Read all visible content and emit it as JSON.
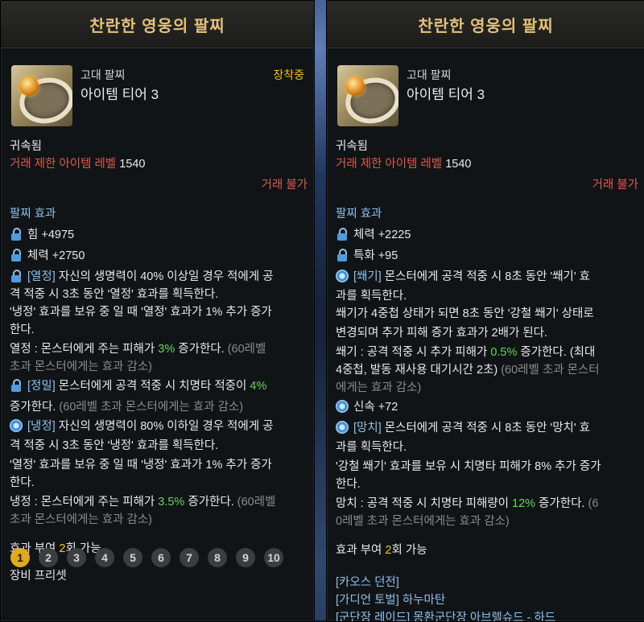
{
  "left": {
    "title": "찬란한 영웅의 팔찌",
    "grade": "고대 팔찌",
    "tier": "아이템 티어 3",
    "equipped": "장착중",
    "bound": "귀속됨",
    "trade_limit_label": "거래 제한 아이템 레벨",
    "trade_limit_value": "1540",
    "untradeable": "거래 불가",
    "effects_header": "팔찌 효과",
    "stat1": "힘 +4975",
    "stat2": "체력 +2750",
    "e1": {
      "tag": "[열정]",
      "l1": " 자신의 생명력이 40% 이상일 경우 적에게 공",
      "l2": "격 적중 시 3초 동안 '열정' 효과를 획득한다.",
      "l3": "'냉정' 효과를 보유 중 일 때 '열정' 효과가 1% 추가 증가",
      "l4": "한다.",
      "l5a": "열정 : 몬스터에게 주는 피해가 ",
      "l5v": "3%",
      "l5b": " 증가한다. ",
      "l5c": "(60레벨",
      "l6": "초과 몬스터에게는 효과 감소)"
    },
    "e2": {
      "tag": "[정밀]",
      "l1a": " 몬스터에게 공격 적중 시 치명타 적중이 ",
      "l1v": "4%",
      "l2a": "증가한다. ",
      "l2b": "(60레벨 초과 몬스터에게는 효과 감소)"
    },
    "e3": {
      "tag": "[냉정]",
      "l1": " 자신의 생명력이 80% 이하일 경우 적에게 공",
      "l2": "격 적중 시 3초 동안 '냉정' 효과를 획득한다.",
      "l3": "'열정' 효과를 보유 중 일 때 '냉정' 효과가 1% 추가 증가",
      "l4": "한다.",
      "l5a": "냉정 : 몬스터에게 주는 피해가 ",
      "l5v": "3.5%",
      "l5b": " 증가한다. ",
      "l5c": "(60레벨",
      "l6": "초과 몬스터에게는 효과 감소)"
    },
    "grant_a": "효과 부여 ",
    "grant_n": "2",
    "grant_b": "회 가능",
    "preset_label": "장비 프리셋",
    "presets": [
      "1",
      "2",
      "3",
      "4",
      "5",
      "6",
      "7",
      "8",
      "9",
      "10"
    ],
    "active_preset": "1"
  },
  "right": {
    "title": "찬란한 영웅의 팔찌",
    "grade": "고대 팔찌",
    "tier": "아이템 티어 3",
    "bound": "귀속됨",
    "trade_limit_label": "거래 제한 아이템 레벨",
    "trade_limit_value": "1540",
    "untradeable": "거래 불가",
    "effects_header": "팔찌 효과",
    "stat1": "체력 +2225",
    "stat2": "특화 +95",
    "e1": {
      "tag": "[쐐기]",
      "l1": " 몬스터에게 공격 적중 시 8초 동안 '쐐기' 효",
      "l2": "과를 획득한다.",
      "l3": "쐐기가 4중첩 상태가 되면 8초 동안 '강철 쐐기' 상태로",
      "l4": "변경되며 추가 피해 증가 효과가 2배가 된다.",
      "l5a": "쐐기 : 공격 적중 시 추가 피해가 ",
      "l5v": "0.5%",
      "l5b": " 증가한다. (최대",
      "l6a": "4중첩, 발동 재사용 대기시간 2초) ",
      "l6b": "(60레벨 초과 몬스터",
      "l7": "에게는 효과 감소)"
    },
    "stat3": "신속 +72",
    "e2": {
      "tag": "[망치]",
      "l1": " 몬스터에게 공격 적중 시 8초 동안 '망치' 효",
      "l2": "과를 획득한다.",
      "l3": "'강철 쐐기' 효과를 보유 시 치명타 피해가 8% 추가 증가",
      "l4": "한다.",
      "l5a": "망치 : 공격 적중 시 치명타 피해량이 ",
      "l5v": "12%",
      "l5b": " 증가한다. ",
      "l5c": "(6",
      "l6": "0레벨 초과 몬스터에게는 효과 감소)"
    },
    "grant_a": "효과 부여 ",
    "grant_n": "2",
    "grant_b": "회 가능",
    "links": [
      "[카오스 던전]",
      "[가디언 토벌] 하누마탄",
      "[군단장 레이드] 몽환군단장 아브렐슈드 - 하드"
    ]
  }
}
